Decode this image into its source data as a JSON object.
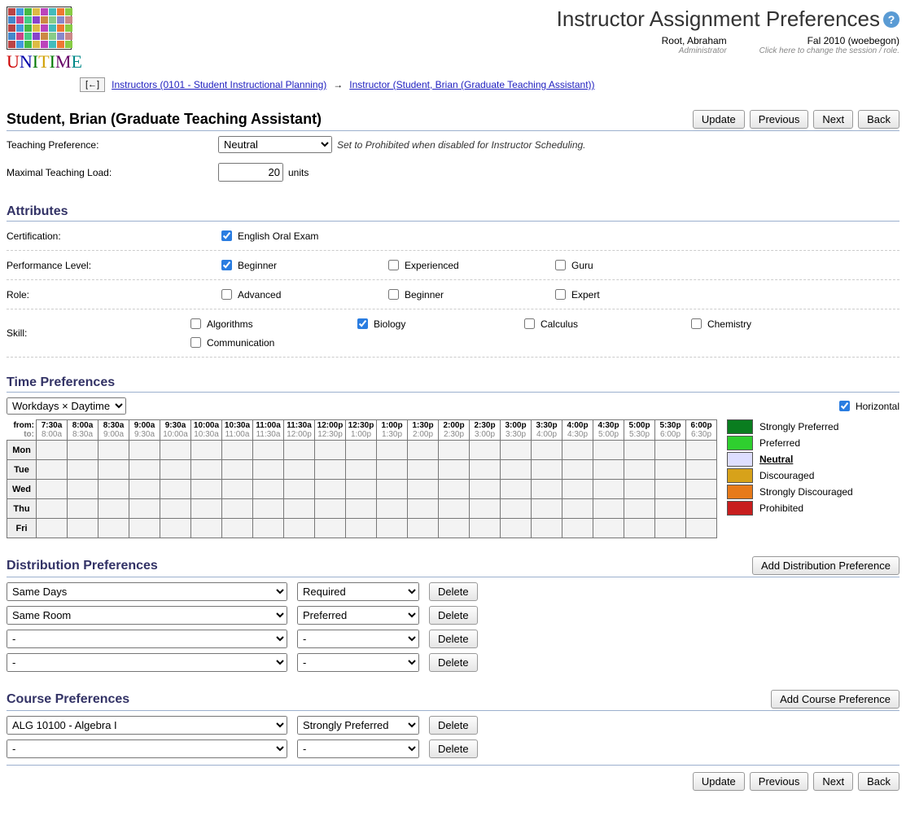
{
  "header": {
    "page_title": "Instructor Assignment Preferences",
    "user_name": "Root, Abraham",
    "user_role": "Administrator",
    "session_name": "Fal 2010 (woebegon)",
    "session_hint": "Click here to change the session / role."
  },
  "breadcrumb": {
    "back_glyph": "[←]",
    "item1": "Instructors (0101 - Student Instructional Planning)",
    "arrow": "→",
    "item2": "Instructor (Student, Brian (Graduate Teaching Assistant))"
  },
  "instructor": {
    "title": "Student, Brian (Graduate Teaching Assistant)"
  },
  "buttons": {
    "update": "Update",
    "previous": "Previous",
    "next": "Next",
    "back": "Back",
    "delete": "Delete",
    "add_dist": "Add Distribution Preference",
    "add_course": "Add Course Preference"
  },
  "teaching": {
    "pref_label": "Teaching Preference:",
    "pref_value": "Neutral",
    "pref_hint": "Set to Prohibited when disabled for Instructor Scheduling.",
    "load_label": "Maximal Teaching Load:",
    "load_value": "20",
    "load_units": "units"
  },
  "attributes": {
    "section_title": "Attributes",
    "rows": [
      {
        "label": "Certification:",
        "items": [
          {
            "label": "English Oral Exam",
            "checked": true
          }
        ]
      },
      {
        "label": "Performance Level:",
        "items": [
          {
            "label": "Beginner",
            "checked": true
          },
          {
            "label": "Experienced",
            "checked": false
          },
          {
            "label": "Guru",
            "checked": false
          }
        ]
      },
      {
        "label": "Role:",
        "items": [
          {
            "label": "Advanced",
            "checked": false
          },
          {
            "label": "Beginner",
            "checked": false
          },
          {
            "label": "Expert",
            "checked": false
          }
        ]
      },
      {
        "label": "Skill:",
        "items": [
          {
            "label": "Algorithms",
            "checked": false
          },
          {
            "label": "Biology",
            "checked": true
          },
          {
            "label": "Calculus",
            "checked": false
          },
          {
            "label": "Chemistry",
            "checked": false
          },
          {
            "label": "Communication",
            "checked": false
          }
        ]
      }
    ]
  },
  "timepref": {
    "section_title": "Time Preferences",
    "mode": "Workdays × Daytime",
    "horizontal_label": "Horizontal",
    "horizontal_checked": true,
    "from_label": "from:",
    "to_label": "to:",
    "days": [
      "Mon",
      "Tue",
      "Wed",
      "Thu",
      "Fri"
    ],
    "times_from": [
      "7:30a",
      "8:00a",
      "8:30a",
      "9:00a",
      "9:30a",
      "10:00a",
      "10:30a",
      "11:00a",
      "11:30a",
      "12:00p",
      "12:30p",
      "1:00p",
      "1:30p",
      "2:00p",
      "2:30p",
      "3:00p",
      "3:30p",
      "4:00p",
      "4:30p",
      "5:00p",
      "5:30p",
      "6:00p"
    ],
    "times_to": [
      "8:00a",
      "8:30a",
      "9:00a",
      "9:30a",
      "10:00a",
      "10:30a",
      "11:00a",
      "11:30a",
      "12:00p",
      "12:30p",
      "1:00p",
      "1:30p",
      "2:00p",
      "2:30p",
      "3:00p",
      "3:30p",
      "4:00p",
      "4:30p",
      "5:00p",
      "5:30p",
      "6:00p",
      "6:30p"
    ],
    "legend": [
      {
        "label": "Strongly Preferred",
        "color": "#0a7d1f",
        "selected": false
      },
      {
        "label": "Preferred",
        "color": "#2fcf2f",
        "selected": false
      },
      {
        "label": "Neutral",
        "color": "#dedeff",
        "selected": true
      },
      {
        "label": "Discouraged",
        "color": "#d7a21a",
        "selected": false
      },
      {
        "label": "Strongly Discouraged",
        "color": "#e77a1a",
        "selected": false
      },
      {
        "label": "Prohibited",
        "color": "#c81e1e",
        "selected": false
      }
    ]
  },
  "dist": {
    "section_title": "Distribution Preferences",
    "rows": [
      {
        "type": "Same Days",
        "pref": "Required"
      },
      {
        "type": "Same Room",
        "pref": "Preferred"
      },
      {
        "type": "-",
        "pref": "-"
      },
      {
        "type": "-",
        "pref": "-"
      }
    ]
  },
  "course": {
    "section_title": "Course Preferences",
    "rows": [
      {
        "course": "ALG 10100 - Algebra I",
        "pref": "Strongly Preferred"
      },
      {
        "course": "-",
        "pref": "-"
      }
    ]
  },
  "logo_colors": [
    "#b44",
    "#49d",
    "#4b4",
    "#db4",
    "#b4b",
    "#4bb",
    "#e73",
    "#8c4",
    "#48c",
    "#c48",
    "#4c8",
    "#84c",
    "#c84",
    "#8c8",
    "#88c",
    "#c88",
    "#b44",
    "#49d",
    "#4b4",
    "#db4",
    "#b4b",
    "#4bb",
    "#e73",
    "#8c4",
    "#48c",
    "#c48",
    "#4c8",
    "#84c",
    "#c84",
    "#8c8",
    "#88c",
    "#c88",
    "#b44",
    "#49d",
    "#4b4",
    "#db4",
    "#b4b",
    "#4bb",
    "#e73",
    "#8c4"
  ]
}
